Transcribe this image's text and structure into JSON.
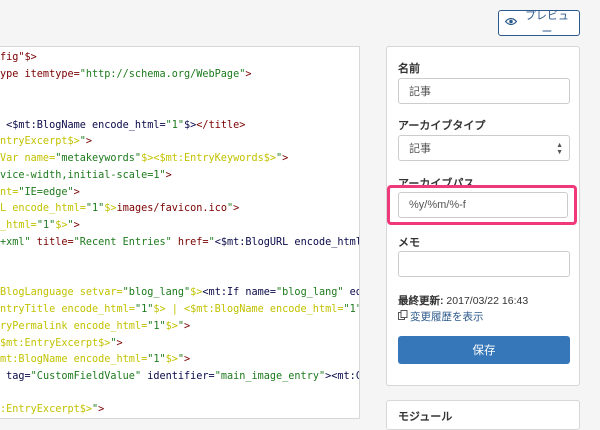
{
  "toolbar": {
    "preview_label": "プレビュー"
  },
  "editor": {
    "lines": [
      [
        "",
        "fig\"$>",
        ""
      ],
      [
        "",
        "ype itemtype=\"http://schema.org/WebPage\">",
        ""
      ],
      [
        "",
        "",
        ""
      ],
      [
        "",
        " <$mt:BlogName encode_html=\"1\"$></title>",
        ""
      ],
      [
        "",
        "ntryExcerpt$>\">",
        ""
      ],
      [
        "",
        "Var name=\"metakeywords\"$><$mt:EntryKeywords$>\">",
        ""
      ],
      [
        "",
        "vice-width,initial-scale=1\">",
        ""
      ],
      [
        "",
        "nt=\"IE=edge\">",
        ""
      ],
      [
        "",
        "L encode_html=\"1\"$>images/favicon.ico\">",
        ""
      ],
      [
        "",
        "_html=\"1\"$>\">",
        ""
      ],
      [
        "",
        "+xml\" title=\"Recent Entries\" href=\"<$mt:BlogURL encode_html=\"1",
        ""
      ],
      [
        "",
        "",
        ""
      ],
      [
        "",
        "",
        ""
      ],
      [
        "",
        "BlogLanguage setvar=\"blog_lang\"$><mt:If name=\"blog_lang\" eq=",
        ""
      ],
      [
        "",
        "ntryTitle encode_html=\"1\"$> | <$mt:BlogName encode_html=\"1\"$",
        ""
      ],
      [
        "",
        "ryPermalink encode_html=\"1\"$>\">",
        ""
      ],
      [
        "",
        "$mt:EntryExcerpt$>\">",
        ""
      ],
      [
        "",
        "mt:BlogName encode_html=\"1\"$>\">",
        ""
      ],
      [
        "",
        " tag=\"CustomFieldValue\" identifier=\"main_image_entry\"><mt:Cus",
        ""
      ],
      [
        "",
        "",
        ""
      ],
      [
        "",
        ":EntryExcerpt$>\">",
        ""
      ]
    ]
  },
  "settings": {
    "name_label": "名前",
    "name_value": "記事",
    "archive_type_label": "アーカイブタイプ",
    "archive_type_value": "記事",
    "archive_path_label": "アーカイブパス",
    "archive_path_value": "%y/%m/%-f",
    "memo_label": "メモ",
    "memo_value": "",
    "last_updated_label": "最終更新:",
    "last_updated_value": "2017/03/22 16:43",
    "history_link": "変更履歴を表示",
    "save_label": "保存"
  },
  "module": {
    "title": "モジュール"
  },
  "colors": {
    "accent": "#3677b9",
    "highlight": "#f0397b"
  }
}
